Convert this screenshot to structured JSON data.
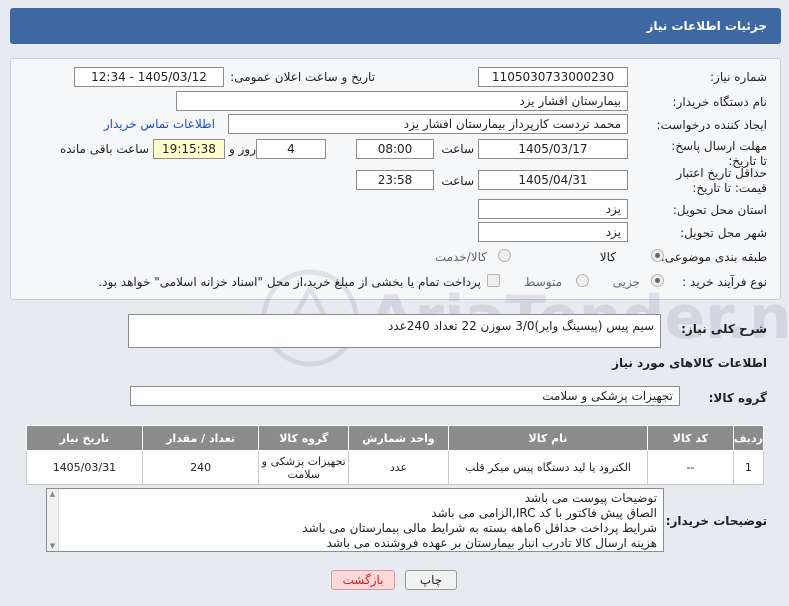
{
  "header": {
    "title": "جزئیات اطلاعات نیاز"
  },
  "form": {
    "need_number": {
      "label": "شماره نیاز:",
      "value": "1105030733000230"
    },
    "announce_datetime": {
      "label": "تاریخ و ساعت اعلان عمومی:",
      "value": "1405/03/12 - 12:34"
    },
    "buyer_org": {
      "label": "نام دستگاه خریدار:",
      "value": "بیمارستان افشار یزد"
    },
    "requester": {
      "label": "ایجاد کننده درخواست:",
      "value": "محمد تردست کارپرداز بیمارستان افشار یزد",
      "contact_link": "اطلاعات تماس خریدار"
    },
    "reply_deadline": {
      "label": "مهلت ارسال پاسخ: تا تاریخ:",
      "date": "1405/03/17",
      "time_label": "ساعت",
      "time": "08:00",
      "days": "4",
      "days_label": "روز و",
      "remaining": "19:15:38",
      "remaining_label": "ساعت باقی مانده"
    },
    "price_validity": {
      "label": "حداقل تاریخ اعتبار قیمت: تا تاریخ:",
      "date": "1405/04/31",
      "time_label": "ساعت",
      "time": "23:58"
    },
    "province": {
      "label": "استان محل تحویل:",
      "value": "یزد"
    },
    "city": {
      "label": "شهر محل تحویل:",
      "value": "یزد"
    },
    "category": {
      "label": "طبقه بندی موضوعی:",
      "options": [
        "کالا",
        "کالا/خدمت"
      ]
    },
    "purchase_type": {
      "label": "نوع فرآیند خرید :",
      "options": [
        "جزیی",
        "متوسط"
      ],
      "note": "پرداخت تمام یا بخشی از مبلغ خرید،از محل \"اسناد خزانه اسلامی\" خواهد بود."
    }
  },
  "summary": {
    "label": "شرح کلی نیاز:",
    "value": "سیم پیس (پیسینگ وایر)3/0 سوزن 22 تعداد 240عدد"
  },
  "goods_info": {
    "title": "اطلاعات کالاهای مورد نیاز",
    "group_label": "گروه کالا:",
    "group_value": "تجهیزات پزشکی و سلامت"
  },
  "table": {
    "columns": [
      "ردیف",
      "کد کالا",
      "نام کالا",
      "واحد شمارش",
      "گروه کالا",
      "تعداد / مقدار",
      "تاریخ نیاز"
    ],
    "rows": [
      [
        "1",
        "--",
        "الکترود یا لید دستگاه پیس میکر قلب",
        "عدد",
        "تجهیزات پزشکی و سلامت",
        "240",
        "1405/03/31"
      ]
    ]
  },
  "buyer_notes": {
    "label": "توضیحات خریدار:",
    "lines": [
      "توضیحات پیوست می باشد",
      "الصاق پیش فاکتور با کد  IRC,الزامی می باشد",
      "شرایط پرداخت حداقل 6ماهه بسته به شرایط مالی بیمارستان می باشد",
      "هزینه ارسال کالا تادرب انبار بیمارستان بر عهده فروشنده می باشد"
    ]
  },
  "buttons": {
    "print": "چاپ",
    "back": "بازگشت"
  },
  "watermark": "AriaTender.net"
}
